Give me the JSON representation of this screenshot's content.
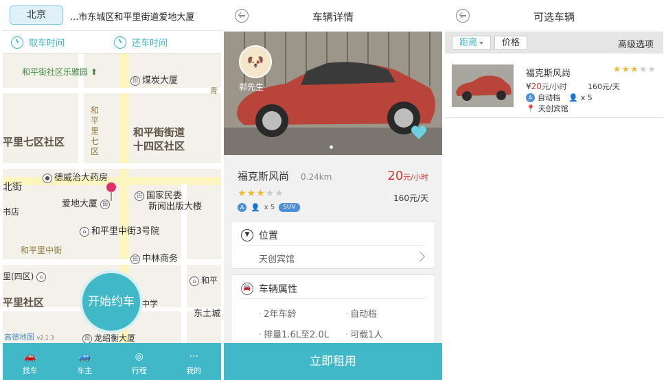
{
  "screen1": {
    "city": "北京",
    "address": "...市东城区和平里街道爱地大厦",
    "pickup_time": "取车时间",
    "return_time": "还车时间",
    "map_labels": {
      "l1": "和平街社区乐雅园",
      "l2": "煤炭大厦",
      "l3": "和平里七区",
      "l4": "和平街街道",
      "l5": "十四区社区",
      "l6": "平里七区社区",
      "l7": "德威治大药房",
      "l8": "北街",
      "l9": "国家民委",
      "l10": "新闻出版大楼",
      "l11": "爱地大厦",
      "l12": "书店",
      "l13": "和平里中街3号院",
      "l14": "和平里中街",
      "l15": "中林商务",
      "l16": "里(四区)",
      "l17": "和平",
      "l18": "平里社区",
      "l19": "中学",
      "l20": "东土城",
      "l21": "龙绍衡大厦",
      "l22": "青"
    },
    "start_button": "开始约车",
    "map_logo": "高德地图",
    "map_version": "v2.1.3",
    "tabs": [
      {
        "label": "找车",
        "icon": "car-search-icon"
      },
      {
        "label": "车主",
        "icon": "car-owner-icon"
      },
      {
        "label": "行程",
        "icon": "trip-icon"
      },
      {
        "label": "我的",
        "icon": "more-icon"
      }
    ]
  },
  "screen2": {
    "title": "车辆详情",
    "owner_name": "郭先生",
    "model": "福克斯风尚",
    "distance": "0.24km",
    "price_hour_value": "20",
    "price_hour_unit": "元/小时",
    "price_day": "160元/天",
    "rating": 3,
    "seats": "x 5",
    "body_type": "SUV",
    "transmission_badge": "A",
    "location_heading": "位置",
    "location_value": "天创宾馆",
    "attributes_heading": "车辆属性",
    "attributes": [
      "2年车龄",
      "自动档",
      "排量1.6L至2.0L",
      "可载1人"
    ],
    "rent_button": "立即租用"
  },
  "screen3": {
    "title": "可选车辆",
    "filter_distance": "距离",
    "filter_price": "价格",
    "advanced": "高级选项",
    "items": [
      {
        "title": "福克斯风尚",
        "rating": 3,
        "yen": "¥",
        "price_hour_value": "20",
        "price_hour_unit": "元/小时",
        "price_day": "160元/天",
        "transmission": "自动档",
        "transmission_badge": "A",
        "seats": "x 5",
        "location": "天创宾馆"
      }
    ]
  },
  "colors": {
    "accent": "#41b8c8",
    "price": "#d2362f",
    "star": "#f1b92f",
    "badge": "#4d8fd6"
  }
}
